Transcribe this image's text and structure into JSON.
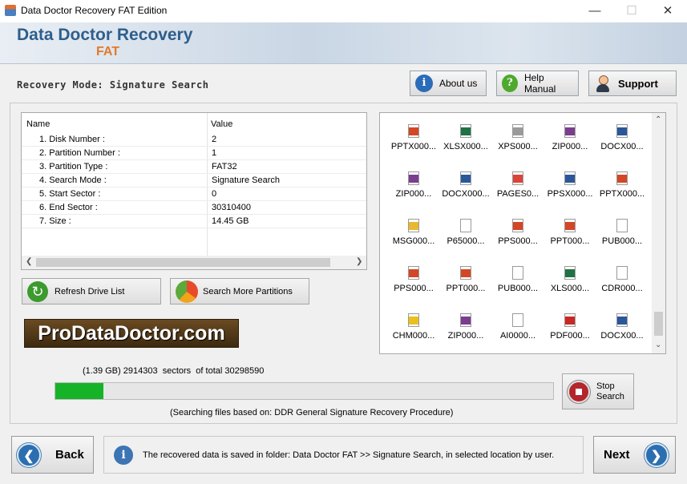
{
  "window": {
    "title": "Data Doctor Recovery FAT Edition",
    "minimize": "—",
    "maximize": "☐",
    "close": "✕"
  },
  "banner": {
    "brand": "Data Doctor Recovery",
    "sub": "FAT"
  },
  "mode": {
    "label": "Recovery Mode: Signature Search"
  },
  "toolbar": {
    "about_label": "About us",
    "help_label": "Help Manual",
    "support_label": "Support"
  },
  "properties": {
    "columns": [
      "Name",
      "Value"
    ],
    "rows": [
      {
        "name": "1. Disk Number :",
        "value": "2"
      },
      {
        "name": "2. Partition Number :",
        "value": "1"
      },
      {
        "name": "3. Partition Type :",
        "value": "FAT32"
      },
      {
        "name": "4. Search Mode :",
        "value": "Signature Search"
      },
      {
        "name": "5. Start Sector :",
        "value": "0"
      },
      {
        "name": "6. End Sector :",
        "value": "30310400"
      },
      {
        "name": "7. Size :",
        "value": "14.45 GB"
      }
    ]
  },
  "actions": {
    "refresh_label": "Refresh Drive List",
    "more_label": "Search More Partitions"
  },
  "logo_text": "ProDataDoctor.com",
  "progress": {
    "size": "(1.39 GB)",
    "sectors": "2914303",
    "mid": "sectors",
    "of_total": "of  total",
    "total": "30298590",
    "fraction": 0.0962,
    "note": "(Searching files based on:  DDR General Signature Recovery Procedure)"
  },
  "stop": {
    "line1": "Stop",
    "line2": "Search"
  },
  "files": [
    {
      "name": "PPTX000...",
      "icon": "pptx-file-icon",
      "color": "#d24726"
    },
    {
      "name": "XLSX000...",
      "icon": "xlsx-file-icon",
      "color": "#1f7244"
    },
    {
      "name": "XPS000...",
      "icon": "xps-file-icon",
      "color": "#9a9a9a"
    },
    {
      "name": "ZIP000...",
      "icon": "zip-file-icon",
      "color": "#7b3e8e"
    },
    {
      "name": "DOCX00...",
      "icon": "docx-file-icon",
      "color": "#2b579a"
    },
    {
      "name": "ZIP000...",
      "icon": "zip-file-icon",
      "color": "#7b3e8e"
    },
    {
      "name": "DOCX000...",
      "icon": "docx-file-icon",
      "color": "#2b579a"
    },
    {
      "name": "PAGES0...",
      "icon": "chrome-file-icon",
      "color": "#db4437"
    },
    {
      "name": "PPSX000...",
      "icon": "ppsx-file-icon",
      "color": "#2b579a"
    },
    {
      "name": "PPTX000...",
      "icon": "pptx-file-icon",
      "color": "#d24726"
    },
    {
      "name": "MSG000...",
      "icon": "msg-file-icon",
      "color": "#e8b830"
    },
    {
      "name": "P65000...",
      "icon": "generic-file-icon",
      "color": "#ffffff"
    },
    {
      "name": "PPS000...",
      "icon": "pps-file-icon",
      "color": "#d24726"
    },
    {
      "name": "PPT000...",
      "icon": "ppt-file-icon",
      "color": "#d24726"
    },
    {
      "name": "PUB000...",
      "icon": "generic-file-icon",
      "color": "#ffffff"
    },
    {
      "name": "PPS000...",
      "icon": "pps-file-icon",
      "color": "#d24726"
    },
    {
      "name": "PPT000...",
      "icon": "ppt-file-icon",
      "color": "#d24726"
    },
    {
      "name": "PUB000...",
      "icon": "generic-file-icon",
      "color": "#ffffff"
    },
    {
      "name": "XLS000...",
      "icon": "xls-file-icon",
      "color": "#1f7244"
    },
    {
      "name": "CDR000...",
      "icon": "generic-file-icon",
      "color": "#ffffff"
    },
    {
      "name": "CHM000...",
      "icon": "chm-file-icon",
      "color": "#e8c020"
    },
    {
      "name": "ZIP000...",
      "icon": "zip-file-icon",
      "color": "#7b3e8e"
    },
    {
      "name": "AI0000...",
      "icon": "generic-file-icon",
      "color": "#ffffff"
    },
    {
      "name": "PDF000...",
      "icon": "pdf-file-icon",
      "color": "#c62a22"
    },
    {
      "name": "DOCX00...",
      "icon": "docx-file-icon",
      "color": "#2b579a"
    }
  ],
  "footer": {
    "back_label": "Back",
    "next_label": "Next",
    "info_text": "The recovered data is saved in folder: Data Doctor FAT  >> Signature Search, in selected location by user."
  }
}
